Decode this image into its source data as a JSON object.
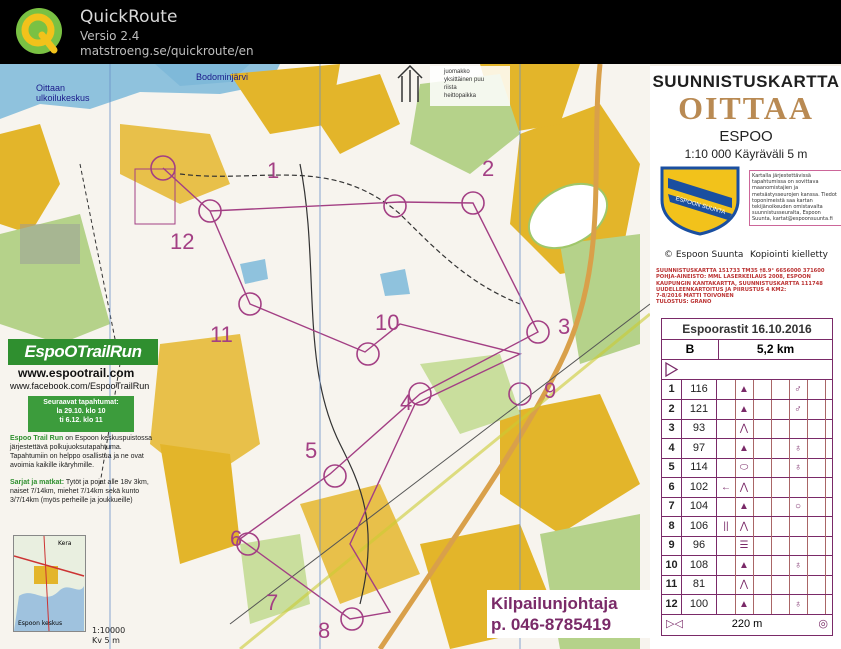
{
  "app": {
    "title": "QuickRoute",
    "version": "Versio 2.4",
    "url": "matstroeng.se/quickroute/en",
    "logo_icon": "quickroute-q-logo-icon"
  },
  "map": {
    "place_labels": [
      "Oittaan ulkoilukeskus",
      "Bodominjärvi"
    ],
    "legend_items": [
      "juomakko",
      "yksittäinen puu",
      "riista",
      "heittopaikka"
    ],
    "control_numbers": [
      "1",
      "2",
      "3",
      "4",
      "5",
      "6",
      "7",
      "8",
      "9",
      "10",
      "11",
      "12"
    ],
    "colors": {
      "course": "#a33f84",
      "open_land": "#e3b52a",
      "forest": "#ffffff",
      "green": "#9fc76a",
      "water": "#7fb9d9"
    }
  },
  "panel": {
    "title_line1": "SUUNNISTUSKARTTA",
    "title_line2": "OITTAA",
    "title_line3": "ESPOO",
    "scale_line": "1:10 000  Käyräväli 5 m",
    "crest_text": "ESPOON SUUNTA",
    "crest_description": "Kartalla järjestettävissä tapahtumissa on sovittava maanomistajien ja metsästysseurojen kanssa. Tiedot toponimeistä saa kartan tekijänoikeuden omistavalta suunnistusseuralta, Espoon Suunta, kartat@espoonsuunta.fi",
    "publisher": "© Espoon Suunta",
    "copying": "Kopiointi kielletty",
    "credits": [
      "SUUNNISTUSKARTTA 151733 TM35 †8.9° 6656000 371600",
      "POHJA-AINEISTO: MML LASERKEILAUS 2008, ESPOON",
      "KAUPUNGIN KANTAKARTTA, SUUNNISTUSKARTTA 111748",
      "UUDELLEENKARTOITUS JA PIIRUSTUS 4 KM2:",
      "7-8/2016 MATTI TOIVONEN",
      "TULOSTUS: GRANO"
    ]
  },
  "description_sheet": {
    "header": "Espoorastit 16.10.2016",
    "class": "B",
    "length": "5,2 km",
    "rows": [
      {
        "n": "1",
        "code": "116",
        "d": "▲",
        "e": "",
        "h": "♂"
      },
      {
        "n": "2",
        "code": "121",
        "d": "▲",
        "e": "",
        "h": "♂"
      },
      {
        "n": "3",
        "code": "93",
        "d": "⋀",
        "e": "",
        "h": ""
      },
      {
        "n": "4",
        "code": "97",
        "d": "▲",
        "e": "",
        "h": "♁"
      },
      {
        "n": "5",
        "code": "114",
        "d": "⬭",
        "e": "",
        "h": "♁"
      },
      {
        "n": "6",
        "code": "102",
        "d": "⋀",
        "e": "←",
        "h": ""
      },
      {
        "n": "7",
        "code": "104",
        "d": "▲",
        "e": "",
        "h": "○"
      },
      {
        "n": "8",
        "code": "106",
        "d": "⋀",
        "e": "||",
        "h": ""
      },
      {
        "n": "9",
        "code": "96",
        "d": "☰",
        "e": "",
        "h": ""
      },
      {
        "n": "10",
        "code": "108",
        "d": "▲",
        "e": "",
        "h": "♁"
      },
      {
        "n": "11",
        "code": "81",
        "d": "⋀",
        "e": "",
        "h": ""
      },
      {
        "n": "12",
        "code": "100",
        "d": "▲",
        "e": "",
        "h": "♁"
      }
    ],
    "finish": "220 m"
  },
  "ad": {
    "logo": "EspoOTrailRun",
    "web": "www.espootrail.com",
    "facebook": "www.facebook.com/EspooTrailRun",
    "next_events_title": "Seuraavat tapahtumat:",
    "next_events": [
      "la 29.10. klo 10",
      "ti 6.12. klo 11"
    ],
    "text_title": "Espoo Trail Run",
    "text": "on Espoon keskuspuistossa järjestettävä polkujuoksutapahtuma. Tapahtumiin on helppo osallistua ja ne ovat avoimia kaikille ikäryhmille.",
    "series_title": "Sarjat ja matkat:",
    "series_text": "Tytöt ja pojat alle 18v 3km, naiset 7/14km, miehet 7/14km sekä kunto 3/7/14km (myös perheille ja joukkueille)",
    "inset_label_1": "Kera",
    "inset_label_2": "Espoon keskus",
    "scale": "1:10000",
    "contour": "Kv 5 m"
  },
  "organizer": {
    "line1": "Kilpailunjohtaja",
    "line2": "p. 046-8785419"
  }
}
